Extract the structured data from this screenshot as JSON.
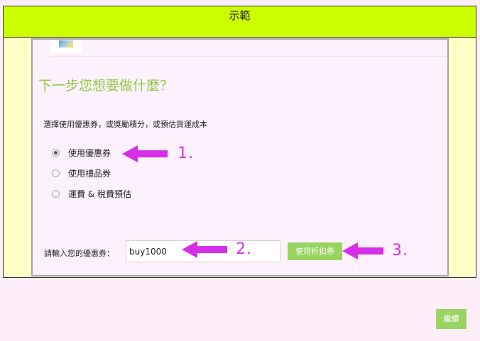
{
  "header": {
    "title": "示範"
  },
  "page": {
    "heading": "下一步您想要做什麼？",
    "instruction": "選擇使用優惠券，或獎勵積分，或預估貨運成本"
  },
  "options": [
    {
      "label": "使用優惠券",
      "checked": true
    },
    {
      "label": "使用禮品券",
      "checked": false
    },
    {
      "label": "運費 & 稅費預估",
      "checked": false
    }
  ],
  "coupon": {
    "label": "請輸入您的優惠券：",
    "value": "buy1000",
    "apply_label": "使用折扣券"
  },
  "footer": {
    "continue_label": "繼續"
  },
  "annotations": {
    "color": "#d62fe8",
    "step1": "1.",
    "step2": "2.",
    "step3": "3."
  }
}
